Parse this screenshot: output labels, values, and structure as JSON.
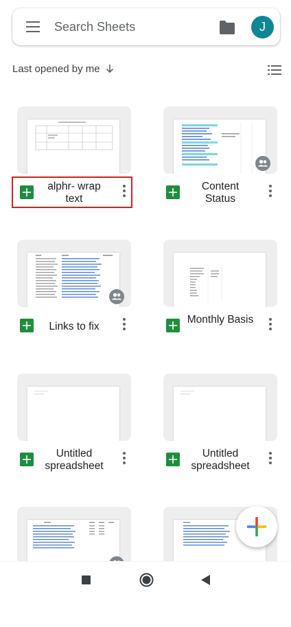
{
  "search": {
    "placeholder": "Search Sheets"
  },
  "account": {
    "initial": "J",
    "color": "#0c8793"
  },
  "sort": {
    "label": "Last opened by me"
  },
  "files": [
    {
      "title": "alphr- wrap text",
      "shared": false,
      "highlighted": true
    },
    {
      "title": "Content Status",
      "shared": true
    },
    {
      "title": "Links to fix",
      "shared": true
    },
    {
      "title": "Monthly Basis",
      "shared": false
    },
    {
      "title": "Untitled spreadsheet",
      "shared": false
    },
    {
      "title": "Untitled spreadsheet",
      "shared": false
    },
    {
      "title": "",
      "shared": true
    },
    {
      "title": "",
      "shared": false
    }
  ],
  "icons": {
    "menu": "menu-icon",
    "folder": "folder-icon",
    "sort": "arrow-down-icon",
    "list_view": "list-view-icon",
    "file_type": "sheets-icon",
    "more": "more-vert-icon",
    "shared": "people-icon",
    "fab": "plus-icon",
    "nav": [
      "square-recents-icon",
      "circle-home-icon",
      "triangle-back-icon"
    ]
  },
  "colors": {
    "sheets_green": "#1e8e3e",
    "highlight": "#d31f1f"
  }
}
